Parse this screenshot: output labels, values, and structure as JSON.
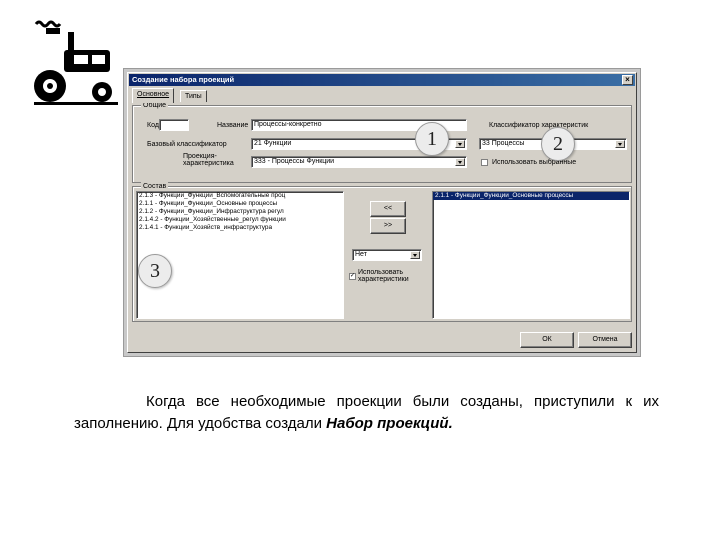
{
  "dialog": {
    "title": "Создание набора проекций",
    "close": "×",
    "tabs": [
      {
        "label": "Основное",
        "active": true
      },
      {
        "label": "Типы",
        "active": false
      }
    ],
    "general_group": {
      "title": "Общие",
      "code_label": "Код",
      "code_value": "",
      "name_label": "Название",
      "name_value": "Процессы-конкретно",
      "base_classifier_label": "Базовый классификатор",
      "base_classifier_value": "21 Функции",
      "projection_char_label": "Проекция-характеристика",
      "projection_char_value": "333 - Процессы Функции",
      "char_classifier_label": "Классификатор характеристик",
      "char_classifier_value": "33 Процессы",
      "use_selected_label": "Использовать выбранные",
      "use_selected_checked": false
    },
    "content_group": {
      "title": "Состав",
      "left_list": [
        "2.1.3 - Функции_Функции_Вспомогательные проц",
        "2.1.1 - Функции_Функции_Основные процессы",
        "2.1.2 - Функции_Функции_Инфраструктура регул",
        "2.1.4.2 - Функции_Хозяйственные_регул функции",
        "2.1.4.1 - Функции_Хозяйств_инфраструктура"
      ],
      "move_left_button": "<<",
      "move_right_button": ">>",
      "type_select_value": "Нет",
      "use_characteristics_label": "Использовать характеристики",
      "use_characteristics_checked": true,
      "right_list": [
        "2.1.1 - Функции_Функции_Основные процессы"
      ]
    },
    "ok_button": "ОК",
    "cancel_button": "Отмена"
  },
  "callouts": [
    "1",
    "2",
    "3"
  ],
  "caption": {
    "text": "Когда все необходимые проекции были созданы, приступили к их заполнению. Для удобства создали ",
    "emphasis": "Набор проекций."
  }
}
